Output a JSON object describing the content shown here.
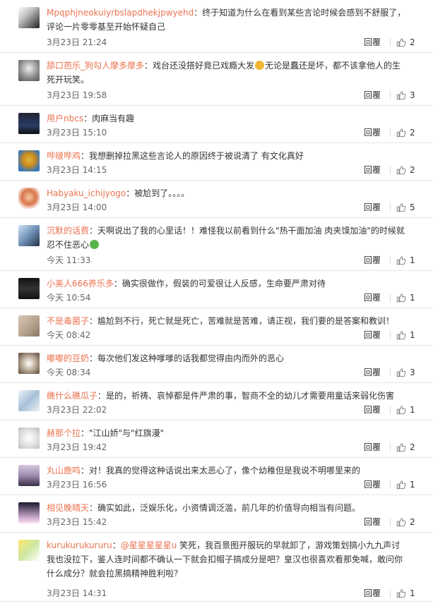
{
  "icons": {
    "thumb": "thumbs-up-icon"
  },
  "colors": {
    "username": "#eb7350",
    "text": "#333333",
    "meta": "#666666"
  },
  "comments": [
    {
      "user": "Mpqphjneokuiyrbslapdhekjpwyehd",
      "body": "：终于知道为什么在看到某些言论时候会感到不舒服了，评论一片零零基至开始怀疑自己",
      "time": "3月23日 21:24",
      "reply": "回覆",
      "likes": "2"
    },
    {
      "user": "舔口芭乐_狗勾人摩多摩多",
      "body": "：戏台还没搭好竟已戏瘾大发",
      "body2": "无论是蠢还是坏，都不该拿他人的生死开玩笑。",
      "time": "3月23日 19:58",
      "reply": "回覆",
      "likes": "3"
    },
    {
      "user": "用户nbcs",
      "body": "：肉麻当有趣",
      "time": "3月23日 15:10",
      "reply": "回覆",
      "likes": "2"
    },
    {
      "user": "哔啵哔鸡",
      "body": "：我想删掉拉黑这些言论人的原因终于被说清了 有文化真好",
      "time": "3月23日 14:15",
      "reply": "回覆",
      "likes": "2"
    },
    {
      "user": "Habyaku_ichijyogo",
      "body": "：被尬到了。。。。",
      "time": "3月23日 14:00",
      "reply": "回覆",
      "likes": "5"
    },
    {
      "user": "沉默的话费",
      "body": "：天啊说出了我的心里话！！难怪我以前看到什么\"热干面加油 肉夹馍加油\"的时候就忍不住恶心",
      "time": "今天 11:33",
      "reply": "回覆",
      "likes": "1"
    },
    {
      "user": "小美人666养乐多",
      "body": "：确实很做作，假装的可爱很让人反感，生命要严肃对待",
      "time": "今天 10:54",
      "reply": "回覆",
      "likes": "1"
    },
    {
      "user": "不是毒菌子",
      "body": "：尴尬到不行，死亡就是死亡，苦难就是苦难，请正视，我们要的是答案和教训！",
      "time": "今天 08:42",
      "reply": "回覆",
      "likes": "1"
    },
    {
      "user": "嘟嘟的豆奶",
      "body": "：每次他们发这种嗲嗲的话我都觉得由内而外的恶心",
      "time": "今天 08:34",
      "reply": "回覆",
      "likes": "3"
    },
    {
      "user": "礁什么礁瓜子",
      "body": "：是的，祈祷、哀悼都是件严肃的事，智商不全的幼儿才需要用童话来弱化伤害",
      "time": "3月23日 22:02",
      "reply": "回覆",
      "likes": "1"
    },
    {
      "user": "赫那个拉",
      "body": "：\"江山娇\"与\"红旗漫\"",
      "time": "3月23日 19:42",
      "reply": "回覆",
      "likes": "2"
    },
    {
      "user": "丸山鹿鸣",
      "body": "：对！我真的觉得这种话说出来太恶心了，像个幼稚但是我说不明哪里来的",
      "time": "3月23日 16:56",
      "reply": "回覆",
      "likes": "1"
    },
    {
      "user": "相见晚晴天",
      "body": "：确实如此，泛娱乐化，小资情调泛滥，前几年的价值导向相当有问题。",
      "time": "3月23日 15:42",
      "reply": "回覆",
      "likes": "2"
    },
    {
      "user": "kurukurukururu",
      "mention": "@星星星星星u",
      "body": " 笑死，我百景图开服玩的早就卸了，游戏策划搞小九九声讨我也没拉下，鉴人连时间都不确认一下就会扣帽子搞成分是吧？皇汉也很喜欢看那免喊，敢问你什么成分？就会拉黑搞精神胜利啦？",
      "time": "3月23日 14:31",
      "reply": "回覆",
      "likes": "1"
    }
  ]
}
